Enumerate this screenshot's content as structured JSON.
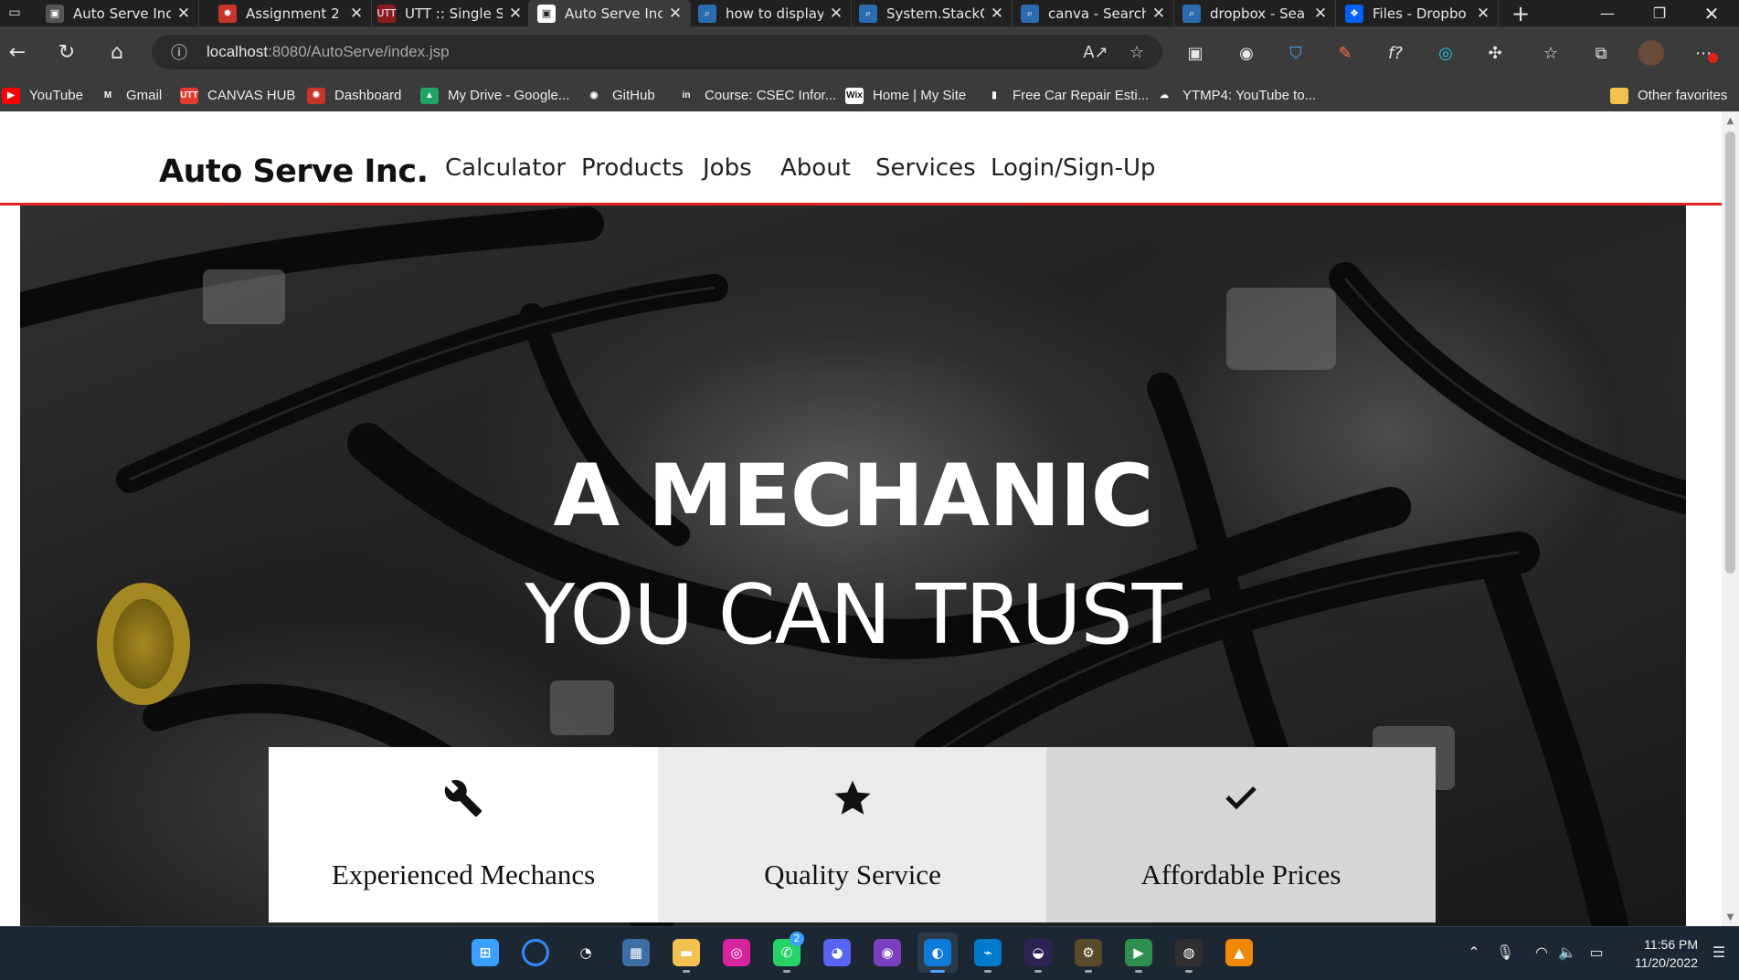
{
  "browser": {
    "tabs": [
      {
        "label": "Auto Serve Inc",
        "favicon_color": "#555555",
        "favicon_glyph": "▣"
      },
      {
        "label": "Assignment 2",
        "favicon_color": "#c8342b",
        "favicon_glyph": "✹"
      },
      {
        "label": "UTT :: Single S",
        "favicon_color": "#8a1c1c",
        "favicon_glyph": "UTT"
      },
      {
        "label": "Auto Serve Inc",
        "favicon_color": "#ffffff",
        "favicon_glyph": "▣"
      },
      {
        "label": "how to display",
        "favicon_color": "#2b6cb0",
        "favicon_glyph": "⌕"
      },
      {
        "label": "System.StackO",
        "favicon_color": "#2b6cb0",
        "favicon_glyph": "⌕"
      },
      {
        "label": "canva - Search",
        "favicon_color": "#2b6cb0",
        "favicon_glyph": "⌕"
      },
      {
        "label": "dropbox - Sea",
        "favicon_color": "#2b6cb0",
        "favicon_glyph": "⌕"
      },
      {
        "label": "Files - Dropbo",
        "favicon_color": "#0061fe",
        "favicon_glyph": "❖"
      }
    ],
    "active_tab_index": 3,
    "url_host": "localhost",
    "url_rest": ":8080/AutoServe/index.jsp",
    "bookmarks": [
      {
        "label": "YouTube",
        "color": "#ff0000",
        "glyph": "▶"
      },
      {
        "label": "Gmail",
        "color": "#3b3b3b",
        "glyph": "M"
      },
      {
        "label": "CANVAS HUB",
        "color": "#e13b2e",
        "glyph": "UTT"
      },
      {
        "label": "Dashboard",
        "color": "#c8342b",
        "glyph": "✹"
      },
      {
        "label": "My Drive - Google...",
        "color": "#1fa463",
        "glyph": "▲"
      },
      {
        "label": "GitHub",
        "color": "#3b3b3b",
        "glyph": "◉"
      },
      {
        "label": "Course: CSEC Infor...",
        "color": "#3b3b3b",
        "glyph": "in"
      },
      {
        "label": "Home | My Site",
        "color": "#ffffff",
        "glyph": "Wix"
      },
      {
        "label": "Free Car Repair Esti...",
        "color": "#3b3b3b",
        "glyph": "▮"
      },
      {
        "label": "YTMP4: YouTube to...",
        "color": "#3b3b3b",
        "glyph": "☁"
      }
    ],
    "other_favorites": "Other favorites"
  },
  "site": {
    "brand": "Auto Serve Inc.",
    "nav": [
      "Calculator",
      "Products",
      "Jobs",
      "About",
      "Services",
      "Login/Sign-Up"
    ],
    "accent_color": "#e2231a",
    "hero": {
      "line1": "A MECHANIC",
      "line2": "YOU CAN TRUST"
    },
    "features": [
      {
        "label": "Experienced Mechancs",
        "icon": "wrench-icon",
        "bg": "#ffffff"
      },
      {
        "label": "Quality Service",
        "icon": "star-icon",
        "bg": "#ebebeb"
      },
      {
        "label": "Affordable Prices",
        "icon": "checkmark-icon",
        "bg": "#d6d6d6"
      }
    ]
  },
  "taskbar": {
    "apps": [
      {
        "name": "start",
        "color": "#3aa0ff"
      },
      {
        "name": "search",
        "color": "#1c2733"
      },
      {
        "name": "chrome-like",
        "color": "#1c2733"
      },
      {
        "name": "photos",
        "color": "#3b6fa6"
      },
      {
        "name": "file-explorer",
        "color": "#f2c14e"
      },
      {
        "name": "instagram",
        "color": "#d6249f"
      },
      {
        "name": "whatsapp",
        "color": "#25d366"
      },
      {
        "name": "discord",
        "color": "#5865f2"
      },
      {
        "name": "github-desktop",
        "color": "#7b3fbf"
      },
      {
        "name": "edge",
        "color": "#0f7bd8"
      },
      {
        "name": "vscode",
        "color": "#007acc"
      },
      {
        "name": "eclipse",
        "color": "#2c2255"
      },
      {
        "name": "settings-app",
        "color": "#5a4a2a"
      },
      {
        "name": "media-app",
        "color": "#2f8f4e"
      },
      {
        "name": "obs",
        "color": "#302e31"
      },
      {
        "name": "drawio",
        "color": "#f08705"
      }
    ],
    "whatsapp_badge": "2",
    "time": "11:56 PM",
    "date": "11/20/2022"
  }
}
